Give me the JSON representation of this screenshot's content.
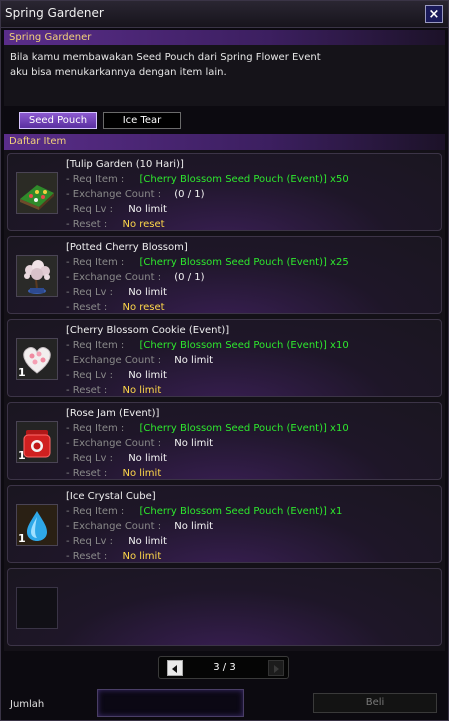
{
  "window": {
    "title": "Spring Gardener",
    "close_icon": "close-icon"
  },
  "info": {
    "header": "Spring Gardener",
    "lines": [
      "Bila kamu membawakan Seed Pouch dari Spring Flower Event",
      "aku bisa menukarkannya dengan item lain."
    ]
  },
  "tabs": [
    {
      "label": "Seed Pouch",
      "active": true
    },
    {
      "label": "Ice Tear",
      "active": false
    }
  ],
  "list": {
    "header": "Daftar Item",
    "labels": {
      "req_item": "- Req Item :",
      "exchange_count": "- Exchange Count :",
      "req_lv": "- Req Lv :",
      "reset": "- Reset :"
    },
    "items": [
      {
        "name": "[Tulip Garden (10 Hari)]",
        "qty": "",
        "req_item": "[Cherry Blossom Seed Pouch (Event)] x50",
        "exchange_count": "(0 / 1)",
        "req_lv": "No limit",
        "reset": "No reset",
        "icon": "tulip-garden-icon"
      },
      {
        "name": "[Potted Cherry Blossom]",
        "qty": "",
        "req_item": "[Cherry Blossom Seed Pouch (Event)] x25",
        "exchange_count": "(0 / 1)",
        "req_lv": "No limit",
        "reset": "No reset",
        "icon": "potted-cherry-blossom-icon"
      },
      {
        "name": "[Cherry Blossom Cookie (Event)]",
        "qty": "1",
        "req_item": "[Cherry Blossom Seed Pouch (Event)] x10",
        "exchange_count": "No limit",
        "req_lv": "No limit",
        "reset": "No limit",
        "icon": "cherry-blossom-cookie-icon"
      },
      {
        "name": "[Rose Jam (Event)]",
        "qty": "1",
        "req_item": "[Cherry Blossom Seed Pouch (Event)] x10",
        "exchange_count": "No limit",
        "req_lv": "No limit",
        "reset": "No limit",
        "icon": "rose-jam-icon"
      },
      {
        "name": "[Ice Crystal Cube]",
        "qty": "1",
        "req_item": "[Cherry Blossom Seed Pouch (Event)] x1",
        "exchange_count": "No limit",
        "req_lv": "No limit",
        "reset": "No limit",
        "icon": "ice-crystal-cube-icon"
      }
    ]
  },
  "pager": {
    "text": "3 / 3"
  },
  "footer": {
    "qty_label": "Jumlah",
    "qty_value": "",
    "buy_label": "Beli"
  },
  "colors": {
    "accent": "#5a2d8a",
    "req_item": "#2ee82e",
    "no_limit": "#ffd84a"
  }
}
